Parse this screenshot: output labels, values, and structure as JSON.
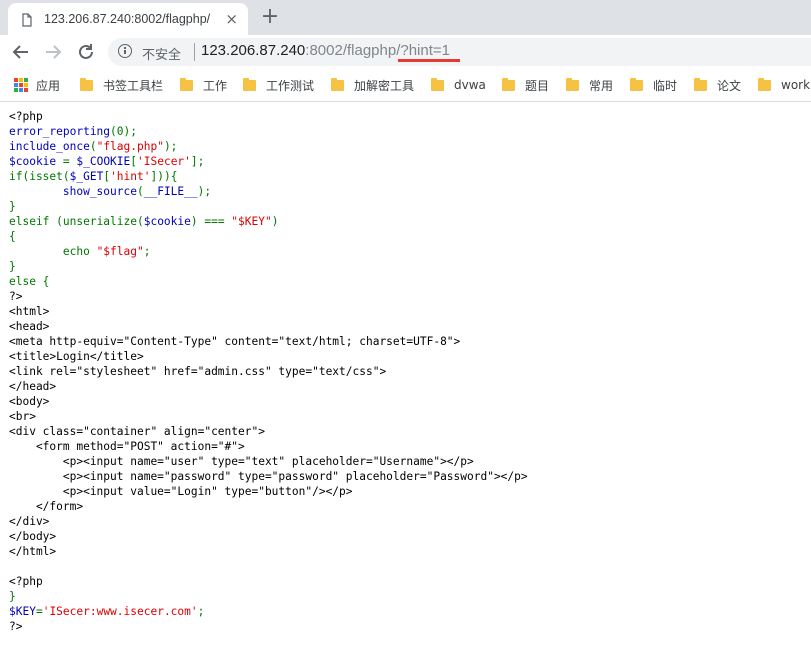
{
  "tab": {
    "title": "123.206.87.240:8002/flagphp/",
    "close": "×"
  },
  "newtab_label": "+",
  "toolbar": {
    "security_text": "不安全",
    "url_host": "123.206.87.240",
    "url_port": ":8002",
    "url_path": "/flagphp/",
    "url_query": "?hint=1"
  },
  "bookmarks": [
    {
      "label": "应用",
      "icon": "apps-icon"
    },
    {
      "label": "书签工具栏",
      "icon": "folder-icon"
    },
    {
      "label": "工作",
      "icon": "folder-icon"
    },
    {
      "label": "工作测试",
      "icon": "folder-icon"
    },
    {
      "label": "加解密工具",
      "icon": "folder-icon"
    },
    {
      "label": "dvwa",
      "icon": "folder-icon"
    },
    {
      "label": "题目",
      "icon": "folder-icon"
    },
    {
      "label": "常用",
      "icon": "folder-icon"
    },
    {
      "label": "临时",
      "icon": "folder-icon"
    },
    {
      "label": "论文",
      "icon": "folder-icon"
    },
    {
      "label": "work",
      "icon": "folder-icon"
    }
  ],
  "colors": {
    "keyword": "#007700",
    "string": "#DD0000",
    "default": "#0000BB",
    "html": "#000000",
    "alert_underline": "#e53935"
  },
  "code_lines": [
    [
      [
        "html",
        "<?php"
      ]
    ],
    [
      [
        "def",
        "error_reporting"
      ],
      [
        "kw",
        "(0);"
      ]
    ],
    [
      [
        "def",
        "include_once"
      ],
      [
        "kw",
        "("
      ],
      [
        "str",
        "\"flag.php\""
      ],
      [
        "kw",
        ");"
      ]
    ],
    [
      [
        "def",
        "$cookie "
      ],
      [
        "kw",
        "= "
      ],
      [
        "def",
        "$_COOKIE"
      ],
      [
        "kw",
        "["
      ],
      [
        "str",
        "'ISecer'"
      ],
      [
        "kw",
        "];"
      ]
    ],
    [
      [
        "kw",
        "if(isset("
      ],
      [
        "def",
        "$_GET"
      ],
      [
        "kw",
        "["
      ],
      [
        "str",
        "'hint'"
      ],
      [
        "kw",
        "])){"
      ]
    ],
    [
      [
        "def",
        "        show_source"
      ],
      [
        "kw",
        "("
      ],
      [
        "def",
        "__FILE__"
      ],
      [
        "kw",
        ");"
      ]
    ],
    [
      [
        "kw",
        "}"
      ]
    ],
    [
      [
        "kw",
        "elseif "
      ],
      [
        "kw",
        "(unserialize("
      ],
      [
        "def",
        "$cookie"
      ],
      [
        "kw",
        ") === "
      ],
      [
        "str",
        "\"$KEY\""
      ],
      [
        "kw",
        ")"
      ]
    ],
    [
      [
        "kw",
        "{"
      ]
    ],
    [
      [
        "kw",
        "        echo "
      ],
      [
        "str",
        "\"$flag\""
      ],
      [
        "kw",
        ";"
      ]
    ],
    [
      [
        "kw",
        "}"
      ]
    ],
    [
      [
        "kw",
        "else {"
      ]
    ],
    [
      [
        "html",
        "?>"
      ]
    ],
    [
      [
        "html",
        "<html>"
      ]
    ],
    [
      [
        "html",
        "<head>"
      ]
    ],
    [
      [
        "html",
        "<meta http-equiv=\"Content-Type\" content=\"text/html; charset=UTF-8\">"
      ]
    ],
    [
      [
        "html",
        "<title>Login</title>"
      ]
    ],
    [
      [
        "html",
        "<link rel=\"stylesheet\" href=\"admin.css\" type=\"text/css\">"
      ]
    ],
    [
      [
        "html",
        "</head>"
      ]
    ],
    [
      [
        "html",
        "<body>"
      ]
    ],
    [
      [
        "html",
        "<br>"
      ]
    ],
    [
      [
        "html",
        "<div class=\"container\" align=\"center\">"
      ]
    ],
    [
      [
        "html",
        "    <form method=\"POST\" action=\"#\">"
      ]
    ],
    [
      [
        "html",
        "        <p><input name=\"user\" type=\"text\" placeholder=\"Username\"></p>"
      ]
    ],
    [
      [
        "html",
        "        <p><input name=\"password\" type=\"password\" placeholder=\"Password\"></p>"
      ]
    ],
    [
      [
        "html",
        "        <p><input value=\"Login\" type=\"button\"/></p>"
      ]
    ],
    [
      [
        "html",
        "    </form>"
      ]
    ],
    [
      [
        "html",
        "</div>"
      ]
    ],
    [
      [
        "html",
        "</body>"
      ]
    ],
    [
      [
        "html",
        "</html>"
      ]
    ],
    [
      [
        "html",
        ""
      ]
    ],
    [
      [
        "html",
        "<?php"
      ]
    ],
    [
      [
        "kw",
        "}"
      ]
    ],
    [
      [
        "def",
        "$KEY"
      ],
      [
        "kw",
        "="
      ],
      [
        "str",
        "'ISecer:www.isecer.com'"
      ],
      [
        "kw",
        ";"
      ]
    ],
    [
      [
        "html",
        "?>"
      ]
    ]
  ]
}
